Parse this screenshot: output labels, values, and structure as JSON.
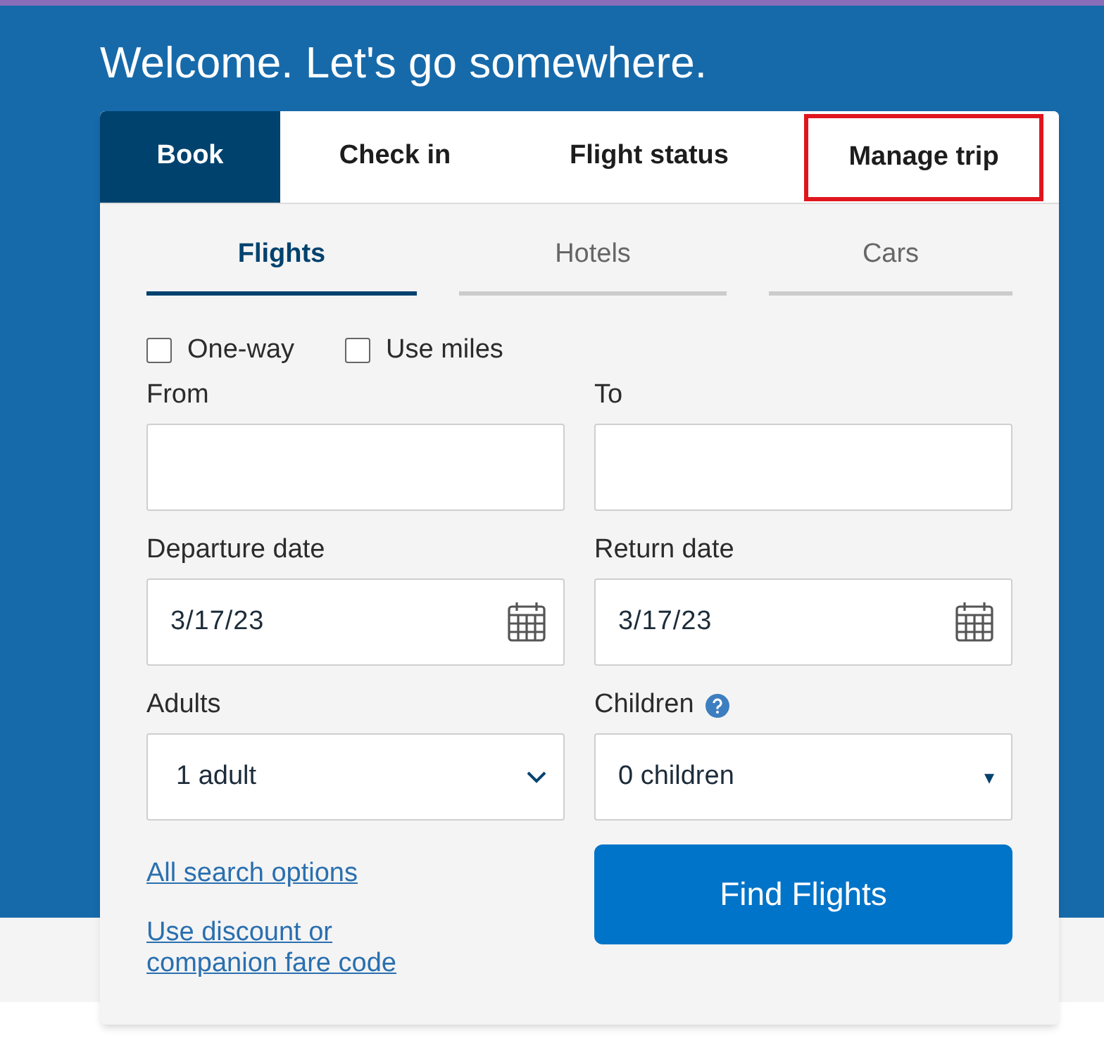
{
  "heading": "Welcome. Let's go somewhere.",
  "tabs": [
    {
      "label": "Book",
      "selected": true,
      "highlighted": false
    },
    {
      "label": "Check in",
      "selected": false,
      "highlighted": false
    },
    {
      "label": "Flight status",
      "selected": false,
      "highlighted": false
    },
    {
      "label": "Manage trip",
      "selected": false,
      "highlighted": true
    }
  ],
  "subtabs": [
    {
      "label": "Flights",
      "selected": true
    },
    {
      "label": "Hotels",
      "selected": false
    },
    {
      "label": "Cars",
      "selected": false
    }
  ],
  "options": [
    {
      "label": "One-way",
      "checked": false
    },
    {
      "label": "Use miles",
      "checked": false
    }
  ],
  "fields": [
    {
      "label": "From",
      "kind": "text"
    },
    {
      "label": "To",
      "kind": "text"
    },
    {
      "label": "Departure date",
      "kind": "date",
      "value": "3/17/23"
    },
    {
      "label": "Return date",
      "kind": "date",
      "value": "3/17/23"
    },
    {
      "label": "Adults",
      "kind": "select",
      "value": "1 adult",
      "help": false
    },
    {
      "label": "Children",
      "kind": "select",
      "value": "0 children",
      "help": true,
      "arrow": "▾"
    }
  ],
  "links": [
    "All search options",
    "Use discount or companion fare code"
  ],
  "submit": "Find Flights"
}
